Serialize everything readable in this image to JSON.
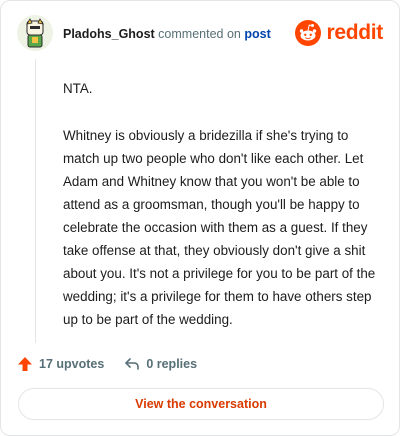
{
  "comment": {
    "username": "Pladohs_Ghost",
    "action_text": "commented on",
    "post_link": "post",
    "paragraphs": [
      "NTA.",
      "Whitney is obviously a bridezilla if she's trying to match up two people who don't like each other. Let Adam and Whitney know that you won't be able to attend as a groomsman, though you'll be happy to celebrate the occasion with them as a guest. If they take offense at that, they obviously don't give a shit about you. It's not a privilege for you to be part of the wedding; it's a privilege for them to have others step up to be part of the wedding."
    ]
  },
  "brand": {
    "name": "reddit",
    "accent": "#ff4500"
  },
  "stats": {
    "upvotes": "17 upvotes",
    "replies": "0 replies"
  },
  "cta": {
    "label": "View the conversation"
  },
  "icons": {
    "upvote": "upvote-arrow-icon",
    "reply": "reply-arrow-icon",
    "logo": "reddit-snoo-icon"
  }
}
